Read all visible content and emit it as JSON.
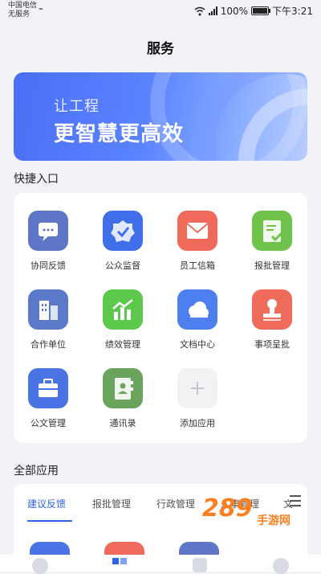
{
  "status_bar": {
    "carrier_1": "中国电信",
    "carrier_2": "无服务",
    "battery": "100%",
    "time": "下午3:21"
  },
  "header": {
    "title": "服务"
  },
  "banner": {
    "line1": "让工程",
    "line2": "更智慧更高效"
  },
  "quick_entry": {
    "title": "快捷入口",
    "items": [
      {
        "label": "协同反馈",
        "icon": "chat-icon",
        "color": "#5f76c7"
      },
      {
        "label": "公众监督",
        "icon": "badge-check-icon",
        "color": "#3f6ee8"
      },
      {
        "label": "员工信箱",
        "icon": "mail-icon",
        "color": "#f06a5b"
      },
      {
        "label": "报批管理",
        "icon": "document-check-icon",
        "color": "#6fc24a"
      },
      {
        "label": "合作单位",
        "icon": "building-icon",
        "color": "#5a79c9"
      },
      {
        "label": "绩效管理",
        "icon": "chart-icon",
        "color": "#5cc94c"
      },
      {
        "label": "文档中心",
        "icon": "cloud-icon",
        "color": "#4d7ff0"
      },
      {
        "label": "事项呈批",
        "icon": "stamp-icon",
        "color": "#ef6c5a"
      },
      {
        "label": "公文管理",
        "icon": "briefcase-icon",
        "color": "#4a74e6"
      },
      {
        "label": "通讯录",
        "icon": "contacts-book-icon",
        "color": "#6aa45c"
      },
      {
        "label": "添加应用",
        "icon": "plus-icon",
        "color": "#f1f2f4"
      }
    ]
  },
  "all_apps": {
    "title": "全部应用",
    "tabs": [
      "建议反馈",
      "报批管理",
      "行政管理",
      "人事管理",
      "文"
    ]
  },
  "watermark": {
    "text": "289",
    "sub": "手游网"
  }
}
